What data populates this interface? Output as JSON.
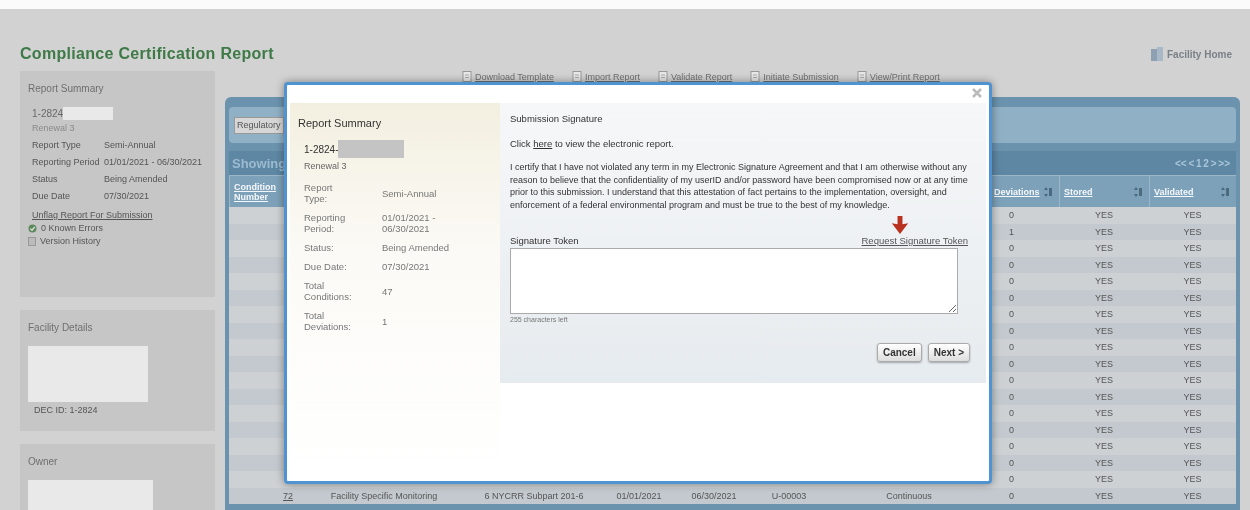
{
  "page_title": "Compliance Certification Report",
  "facility_home": "Facility Home",
  "sidebar": {
    "report_summary": {
      "title": "Report Summary",
      "id": "1-2824",
      "subtitle": "Renewal 3",
      "fields": [
        {
          "label": "Report Type",
          "value": "Semi-Annual"
        },
        {
          "label": "Reporting Period",
          "value": "01/01/2021 - 06/30/2021"
        },
        {
          "label": "Status",
          "value": "Being Amended"
        },
        {
          "label": "Due Date",
          "value": "07/30/2021"
        }
      ],
      "link": "Unflag Report For Submission",
      "errors": "0 Known Errors",
      "history": "Version History"
    },
    "facility_details": {
      "title": "Facility Details",
      "dec_id": "DEC ID: 1-2824"
    },
    "owner": {
      "title": "Owner"
    }
  },
  "toolbar": [
    "Download Template",
    "Import Report",
    "Validate Report",
    "Initiate Submission",
    "View/Print Report"
  ],
  "table": {
    "filter_button": "Regulatory",
    "showing": "Showing",
    "pagination": "<< < 1 2 > >>",
    "header": {
      "number": "Condition Number",
      "deviations": "Deviations",
      "stored": "Stored",
      "validated": "Validated"
    },
    "rows": [
      {
        "deviations": "0",
        "stored": "YES",
        "validated": "YES"
      },
      {
        "deviations": "1",
        "stored": "YES",
        "validated": "YES"
      },
      {
        "deviations": "0",
        "stored": "YES",
        "validated": "YES"
      },
      {
        "deviations": "0",
        "stored": "YES",
        "validated": "YES"
      },
      {
        "deviations": "0",
        "stored": "YES",
        "validated": "YES"
      },
      {
        "deviations": "0",
        "stored": "YES",
        "validated": "YES"
      },
      {
        "deviations": "0",
        "stored": "YES",
        "validated": "YES"
      },
      {
        "deviations": "0",
        "stored": "YES",
        "validated": "YES"
      },
      {
        "deviations": "0",
        "stored": "YES",
        "validated": "YES"
      },
      {
        "deviations": "0",
        "stored": "YES",
        "validated": "YES"
      },
      {
        "deviations": "0",
        "stored": "YES",
        "validated": "YES"
      },
      {
        "deviations": "0",
        "stored": "YES",
        "validated": "YES"
      },
      {
        "deviations": "0",
        "stored": "YES",
        "validated": "YES"
      },
      {
        "deviations": "0",
        "stored": "YES",
        "validated": "YES"
      },
      {
        "deviations": "0",
        "stored": "YES",
        "validated": "YES"
      },
      {
        "deviations": "0",
        "stored": "YES",
        "validated": "YES"
      },
      {
        "deviations": "0",
        "stored": "YES",
        "validated": "YES"
      },
      {
        "number": "72",
        "type": "Facility Specific Monitoring",
        "citation": "6 NYCRR Subpart 201-6",
        "start": "01/01/2021",
        "end": "06/30/2021",
        "unit": "U-00003",
        "frequency": "Continuous",
        "deviations": "0",
        "stored": "YES",
        "validated": "YES"
      }
    ]
  },
  "modal": {
    "summary": {
      "title": "Report Summary",
      "id": "1-2824-",
      "subtitle": "Renewal 3",
      "fields": [
        {
          "label": "Report Type:",
          "value": "Semi-Annual"
        },
        {
          "label": "Reporting Period:",
          "value": "01/01/2021 - 06/30/2021"
        },
        {
          "label": "Status:",
          "value": "Being Amended"
        },
        {
          "label": "Due Date:",
          "value": "07/30/2021"
        },
        {
          "label": "Total Conditions:",
          "value": "47"
        },
        {
          "label": "Total Deviations:",
          "value": "1"
        }
      ]
    },
    "signature": {
      "title": "Submission Signature",
      "click_before": "Click",
      "click_link": "here",
      "click_after": "to view the electronic report.",
      "statement": "I certify that I have not violated any term in my Electronic Signature Agreement and that I am otherwise without any reason to believe that the confidentiality of my userID and/or password have been compromised now or at any time prior to this submission. I understand that this attestation of fact pertains to the implementation, oversight, and enforcement of a federal environmental program and must be true to the best of my knowledge.",
      "token_label": "Signature Token",
      "request_link": "Request Signature Token",
      "chars_left": "255 characters left"
    },
    "buttons": [
      "Cancel",
      "Next >"
    ]
  }
}
